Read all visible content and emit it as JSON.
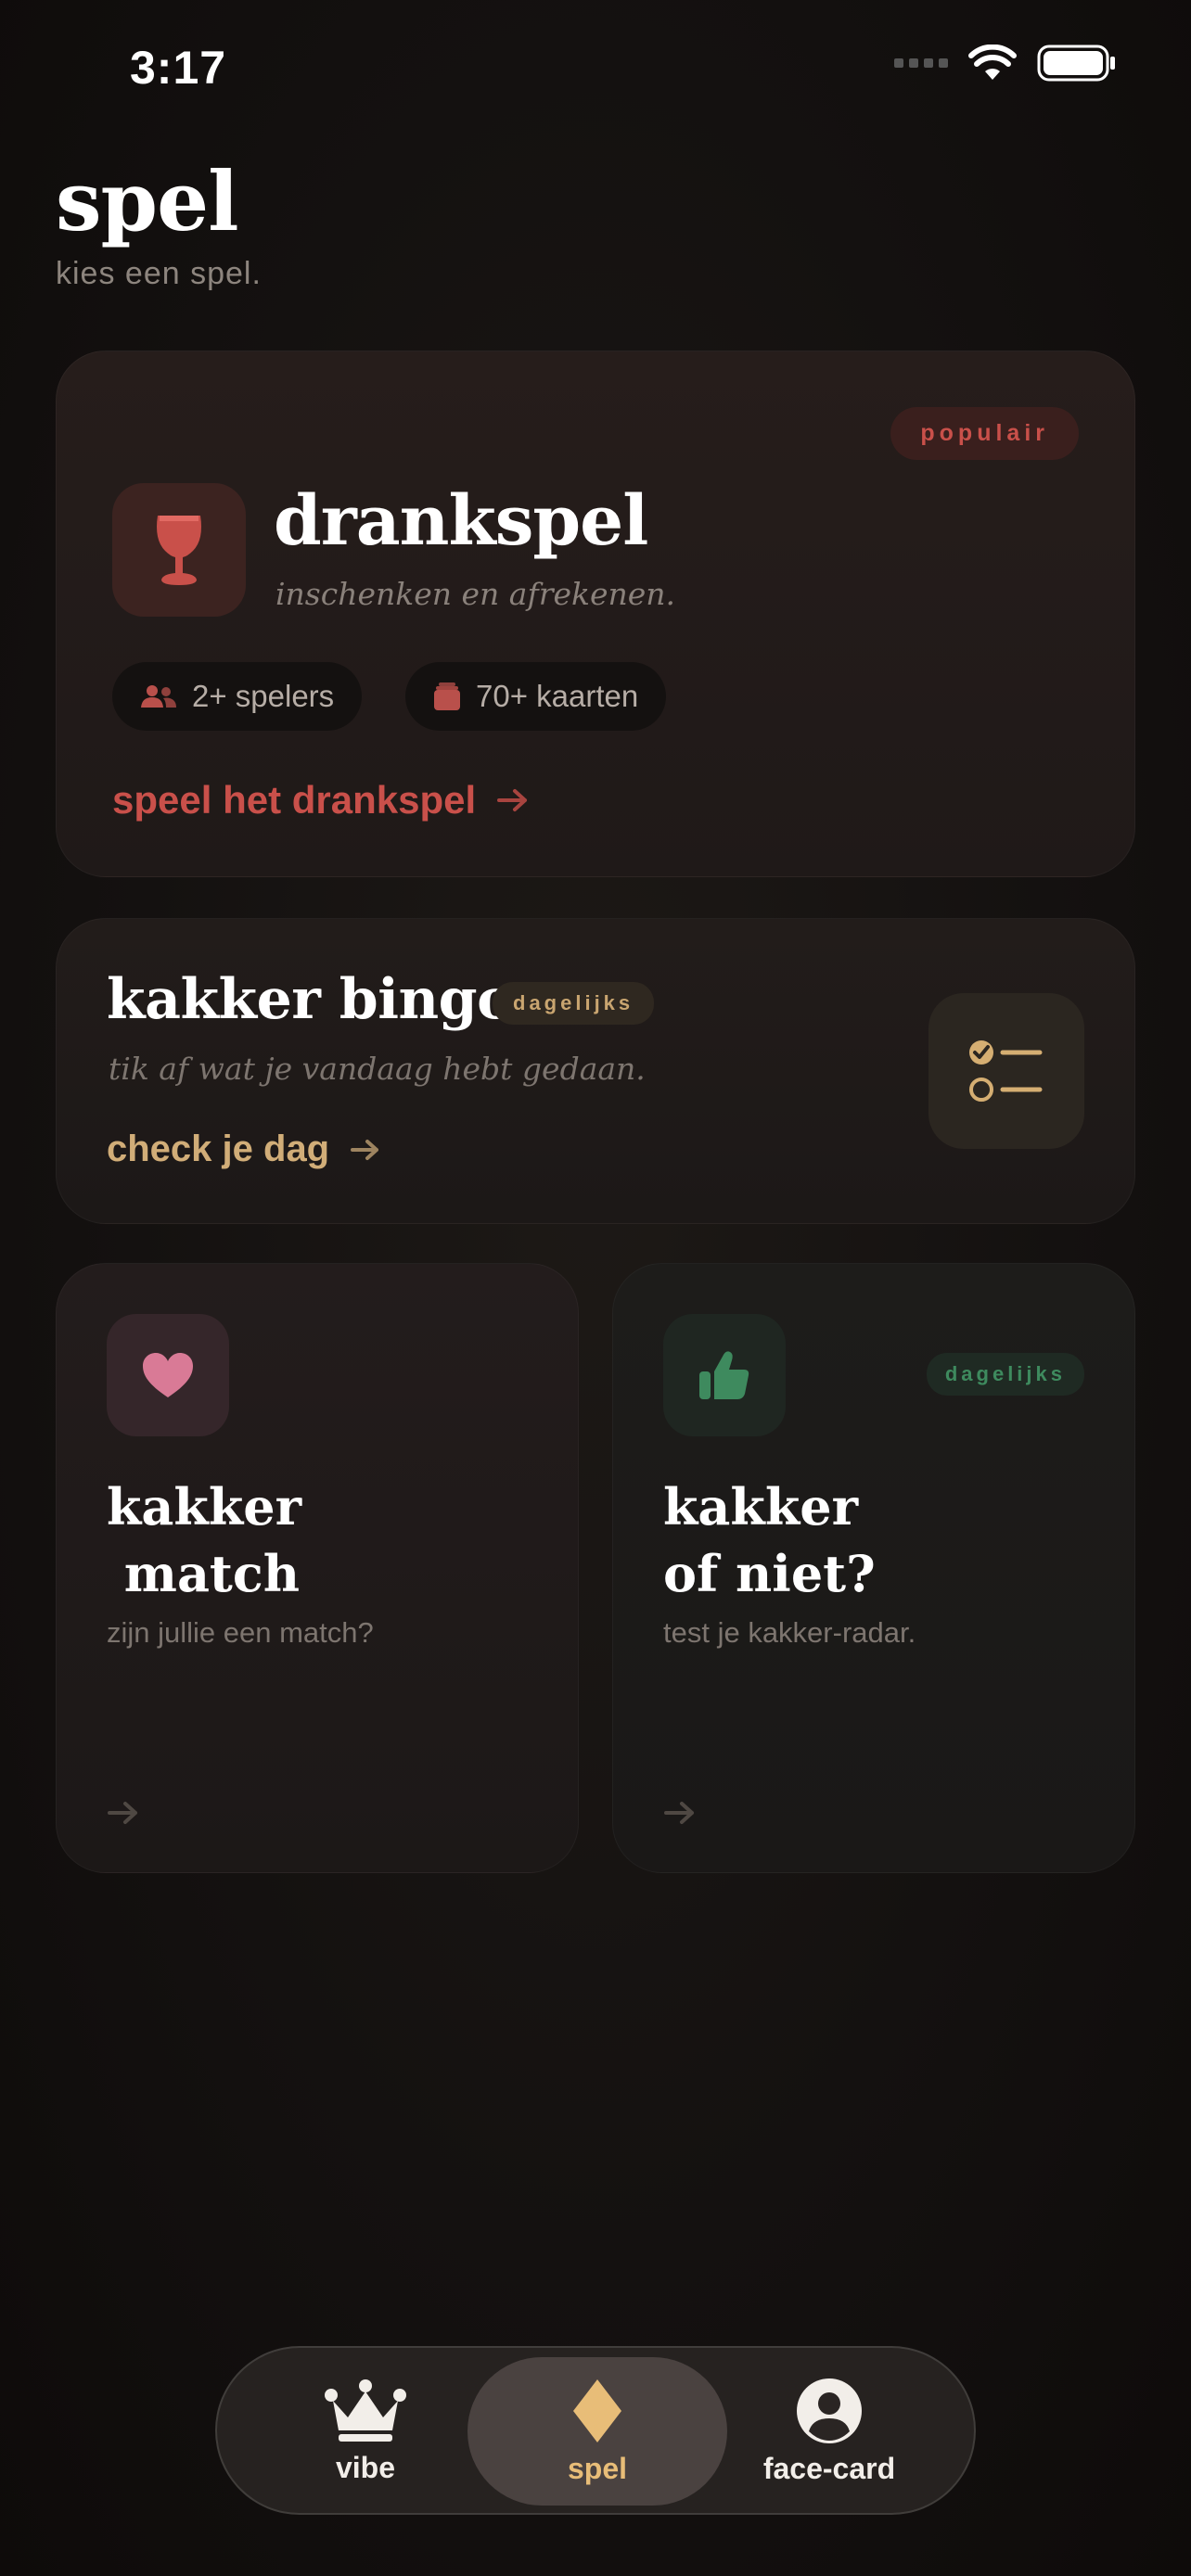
{
  "status_bar": {
    "time": "3:17"
  },
  "header": {
    "title": "spel",
    "subtitle": "kies een spel."
  },
  "drankspel": {
    "badge": "populair",
    "title": "drankspel",
    "subtitle": "inschenken en afrekenen.",
    "chips": {
      "players": "2+ spelers",
      "cards": "70+ kaarten"
    },
    "cta": "speel het drankspel",
    "icon": "wine-glass-icon"
  },
  "bingo": {
    "title": "kakker bingo",
    "badge": "dagelijks",
    "subtitle": "tik af wat je vandaag hebt gedaan.",
    "cta": "check je dag",
    "icon": "checklist-icon"
  },
  "match": {
    "title": "kakker\n match",
    "subtitle": "zijn jullie een match?",
    "icon": "heart-icon"
  },
  "kakker_of_niet": {
    "title": "kakker\nof niet?",
    "subtitle": "test je kakker-radar.",
    "badge": "dagelijks",
    "icon": "thumbs-up-icon"
  },
  "tabbar": {
    "vibe": "vibe",
    "spel": "spel",
    "face_card": "face-card"
  },
  "colors": {
    "accent_red": "#c9504a",
    "accent_gold": "#d1ad78",
    "accent_green": "#3e8a5e",
    "accent_pink": "#d97a96",
    "tab_active": "#e8bd78"
  }
}
